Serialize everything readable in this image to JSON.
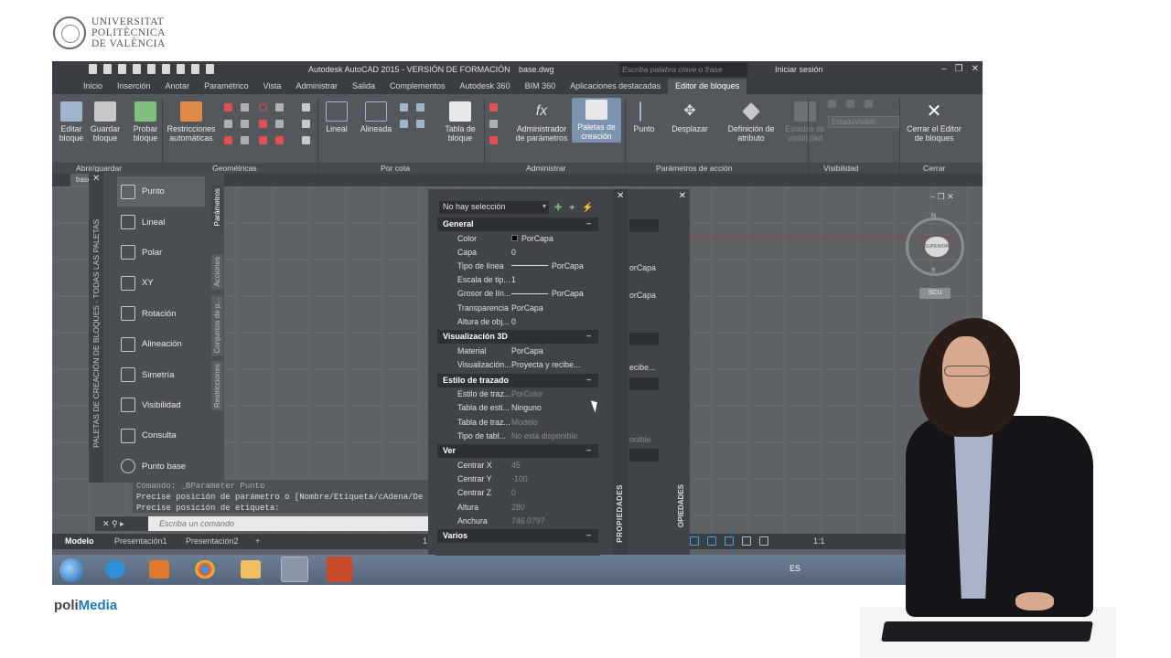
{
  "logo": {
    "line1": "UNIVERSITAT",
    "line2": "POLITÈCNICA",
    "line3": "DE VALÈNCIA"
  },
  "watermark": {
    "poli": "poli",
    "media": "Media"
  },
  "window": {
    "title": "Autodesk AutoCAD 2015 - VERSIÓN DE FORMACIÓN",
    "file": "base.dwg",
    "search_placeholder": "Escriba palabra clave o frase",
    "login": "Iniciar sesión"
  },
  "ribbon_tabs": [
    "Inicio",
    "Inserción",
    "Anotar",
    "Paramétrico",
    "Vista",
    "Administrar",
    "Salida",
    "Complementos",
    "Autodesk 360",
    "BIM 360",
    "Aplicaciones destacadas",
    "Editor de bloques"
  ],
  "ribbon_buttons": {
    "editar": "Editar bloque",
    "guardar": "Guardar bloque",
    "probar": "Probar bloque",
    "restricciones": "Restricciones automáticas",
    "lineal": "Lineal",
    "alineada": "Alineada",
    "tabla": "Tabla de bloque",
    "administrador": "Administrador de parámetros",
    "paletas": "Paletas de creación",
    "punto": "Punto",
    "desplazar": "Desplazar",
    "definicion": "Definición de atributo",
    "estados": "Estados de visibilidad",
    "estado_combo": "EstadoVisibili",
    "cerrar": "Cerrar el Editor de bloques"
  },
  "ribbon_panels": [
    "Abrir/guardar",
    "Geométricas",
    "Por cota",
    "Administrar",
    "Parámetros de acción",
    "Visibilidad",
    "Cerrar"
  ],
  "file_tab": "base",
  "palettes": {
    "vertical_title": "PALETAS DE CREACIÓN DE BLOQUES - TODAS LAS PALETAS",
    "items": [
      "Punto",
      "Lineal",
      "Polar",
      "XY",
      "Rotación",
      "Alineación",
      "Simetría",
      "Visibilidad",
      "Consulta",
      "Punto base"
    ],
    "tabs": [
      "Parámetros",
      "Acciones",
      "Conjuntos de p...",
      "Restricciones"
    ]
  },
  "properties": {
    "selection": "No hay selección",
    "vertical_title": "PROPIEDADES",
    "sections": {
      "general": "General",
      "vis3d": "Visualización 3D",
      "trazado": "Estilo de trazado",
      "ver": "Ver",
      "varios": "Varios"
    },
    "general_rows": [
      {
        "label": "Color",
        "value": "PorCapa"
      },
      {
        "label": "Capa",
        "value": "0"
      },
      {
        "label": "Tipo de línea",
        "value": "PorCapa"
      },
      {
        "label": "Escala de tip...",
        "value": "1"
      },
      {
        "label": "Grosor de lín...",
        "value": "PorCapa"
      },
      {
        "label": "Transparencia",
        "value": "PorCapa"
      },
      {
        "label": "Altura de obj...",
        "value": "0"
      }
    ],
    "vis3d_rows": [
      {
        "label": "Material",
        "value": "PorCapa"
      },
      {
        "label": "Visualización...",
        "value": "Proyecta y recibe..."
      }
    ],
    "trazado_rows": [
      {
        "label": "Estilo de traz...",
        "value": "PorColor"
      },
      {
        "label": "Tabla de esti...",
        "value": "Ninguno"
      },
      {
        "label": "Tabla de traz...",
        "value": "Modelo"
      },
      {
        "label": "Tipo de tabl...",
        "value": "No está disponible"
      }
    ],
    "ver_rows": [
      {
        "label": "Centrar X",
        "value": "45"
      },
      {
        "label": "Centrar Y",
        "value": "-100"
      },
      {
        "label": "Centrar Z",
        "value": "0"
      },
      {
        "label": "Altura",
        "value": "280"
      },
      {
        "label": "Anchura",
        "value": "746.0797"
      }
    ],
    "ghost": {
      "porcapa": "orCapa",
      "recibe": "ecibe...",
      "disp": "onible",
      "vertical": "OPIEDADES"
    }
  },
  "command": {
    "line1": "Comando: _BParameter Punto",
    "line2": "Precise posición de parámetro o [Nombre/Etiqueta/cAdena/De",
    "line3": "Precise posición de etiqueta:",
    "placeholder": "Escriba un comando"
  },
  "layout_tabs": [
    "Modelo",
    "Presentación1",
    "Presentación2"
  ],
  "status": {
    "scale": "1:1",
    "page_num": "1"
  },
  "viewcube": {
    "face": "SUPERIOR",
    "north": "N",
    "south": "S",
    "ucs": "SCU"
  },
  "taskbar": {
    "lang": "ES"
  }
}
